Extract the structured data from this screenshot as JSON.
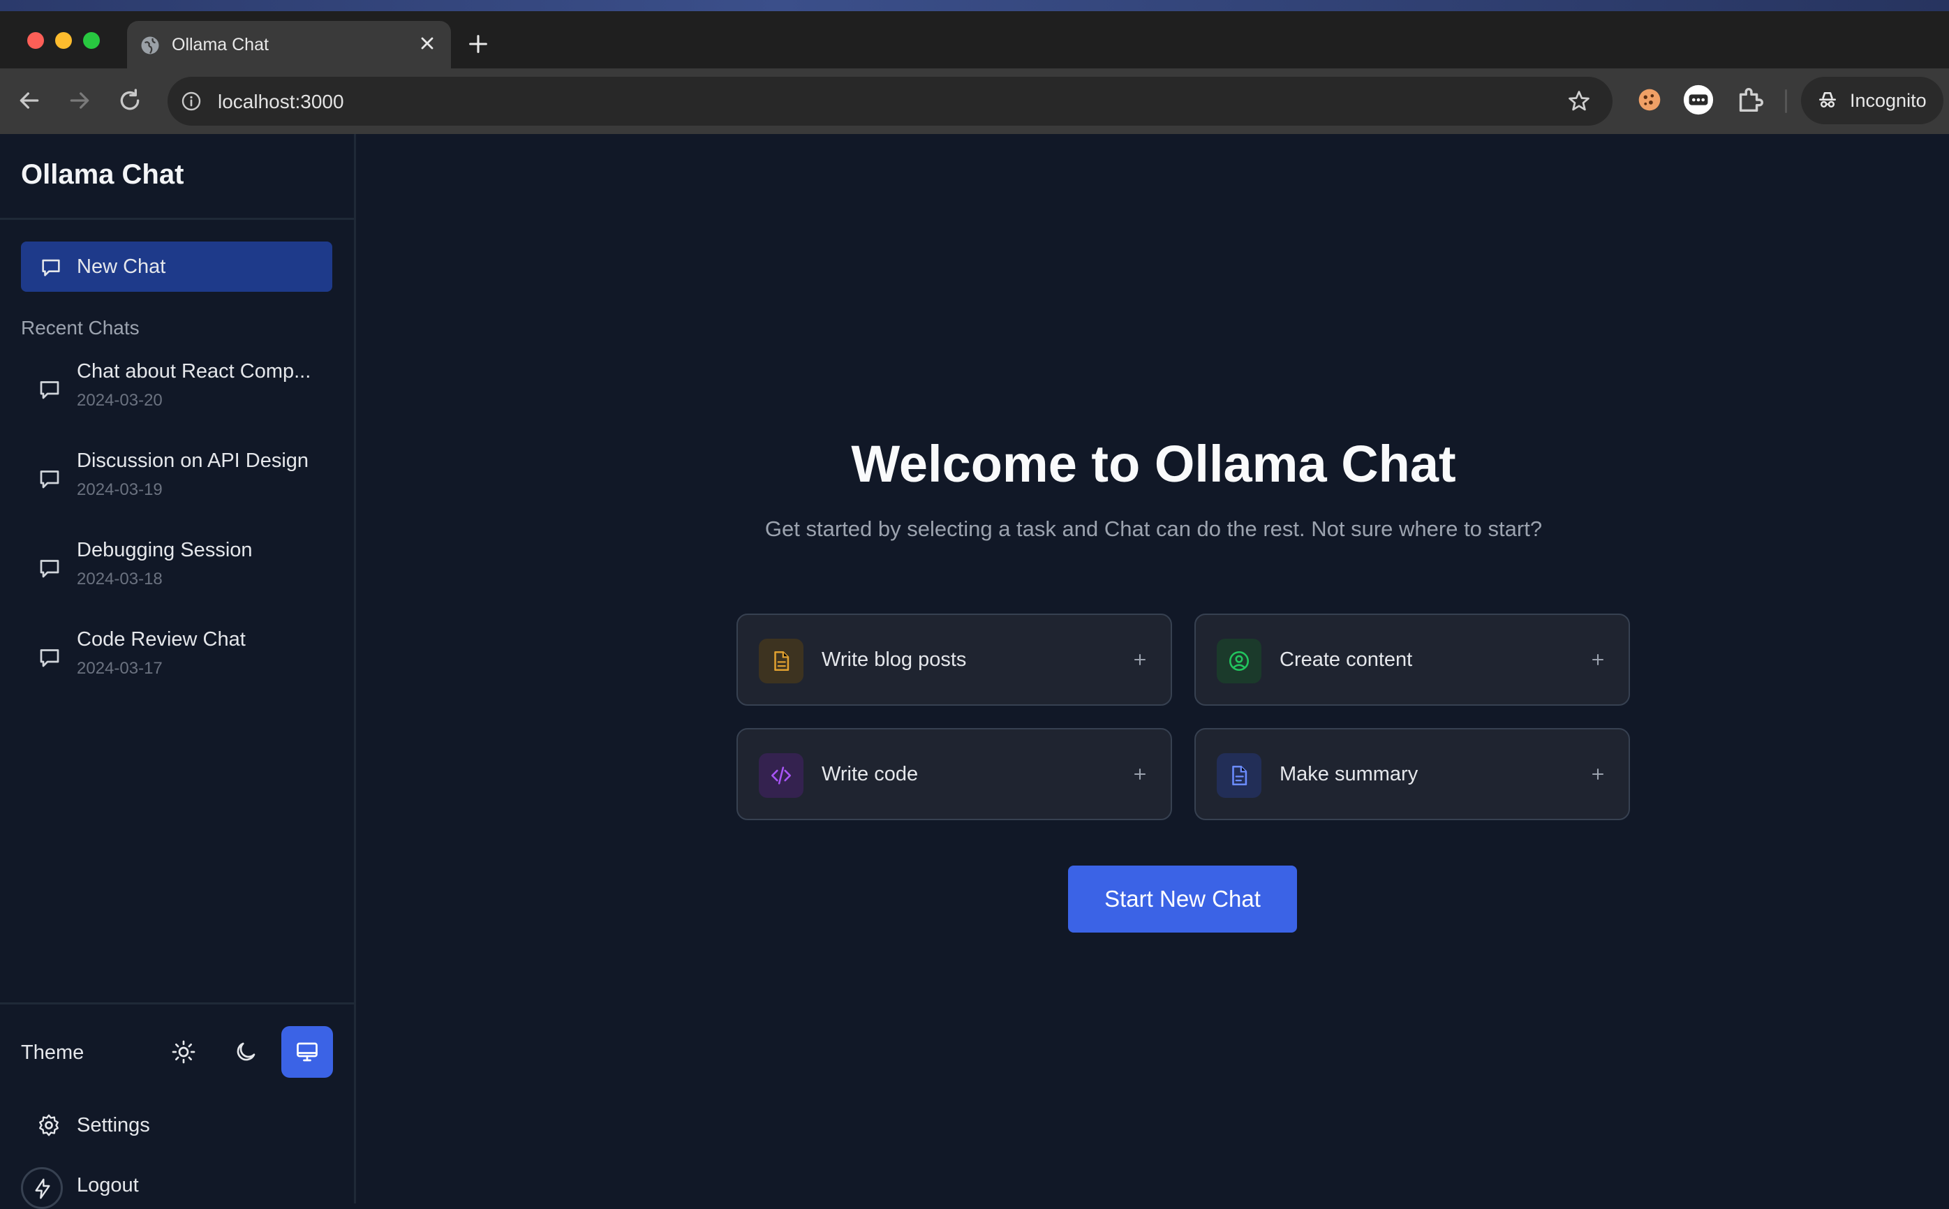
{
  "browser": {
    "tab_title": "Ollama Chat",
    "url": "localhost:3000",
    "profile_label": "Incognito"
  },
  "sidebar": {
    "app_title": "Ollama Chat",
    "new_chat_label": "New Chat",
    "recent_header": "Recent Chats",
    "chats": [
      {
        "title": "Chat about React Comp...",
        "date": "2024-03-20"
      },
      {
        "title": "Discussion on API Design",
        "date": "2024-03-19"
      },
      {
        "title": "Debugging Session",
        "date": "2024-03-18"
      },
      {
        "title": "Code Review Chat",
        "date": "2024-03-17"
      }
    ],
    "theme_label": "Theme",
    "theme_selected": "system",
    "settings_label": "Settings",
    "logout_label": "Logout"
  },
  "main": {
    "title": "Welcome to Ollama Chat",
    "subtitle": "Get started by selecting a task and Chat can do the rest. Not sure where to start?",
    "tasks": [
      {
        "label": "Write blog posts",
        "icon": "document-icon",
        "color": "#e0a030"
      },
      {
        "label": "Create content",
        "icon": "user-circle-icon",
        "color": "#22c55e"
      },
      {
        "label": "Write code",
        "icon": "code-icon",
        "color": "#a855f7"
      },
      {
        "label": "Make summary",
        "icon": "document-text-icon",
        "color": "#6b8cff"
      }
    ],
    "start_button": "Start New Chat"
  },
  "colors": {
    "background": "#111827",
    "accent": "#3b63e6",
    "new_chat_bg": "#1e3a8a"
  }
}
